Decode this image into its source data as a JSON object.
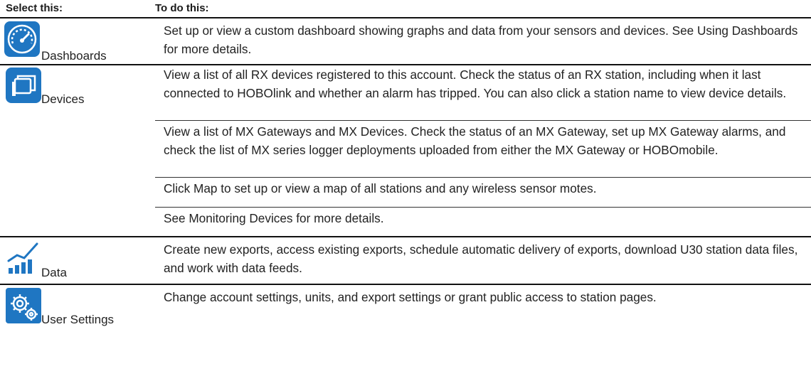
{
  "header": {
    "col1": "Select this:",
    "col2": "To do this:"
  },
  "colors": {
    "icon_blue": "#1f76c2",
    "rule": "#111111"
  },
  "rows": [
    {
      "label": "Dashboards",
      "icon": "speedometer-icon",
      "paragraphs": [
        "Set up or view a custom dashboard showing graphs and data from your sensors and devices. See Using Dashboards for more details."
      ]
    },
    {
      "label": "Devices",
      "icon": "stacked-windows-icon",
      "paragraphs": [
        "View a list of all RX devices registered to this account. Check the status of an RX station, including when it last connected to HOBOlink and whether an alarm has tripped. You can also click a station name to view device details.",
        "View a list of MX Gateways and MX Devices. Check the status of an MX Gateway, set up MX Gateway alarms, and check the list of MX series logger deployments uploaded from either the MX Gateway or HOBOmobile.",
        "Click Map to set up or view a map of all stations and any wireless sensor motes.",
        "See Monitoring Devices for more details."
      ]
    },
    {
      "label": "Data",
      "icon": "bar-chart-trend-icon",
      "paragraphs": [
        "Create new exports, access existing exports, schedule automatic delivery of exports, download U30 station data files, and work with data feeds."
      ]
    },
    {
      "label": "User Settings",
      "icon": "gear-cog-icon",
      "paragraphs": [
        "Change account settings, units, and export settings or grant public access to station pages."
      ]
    }
  ]
}
